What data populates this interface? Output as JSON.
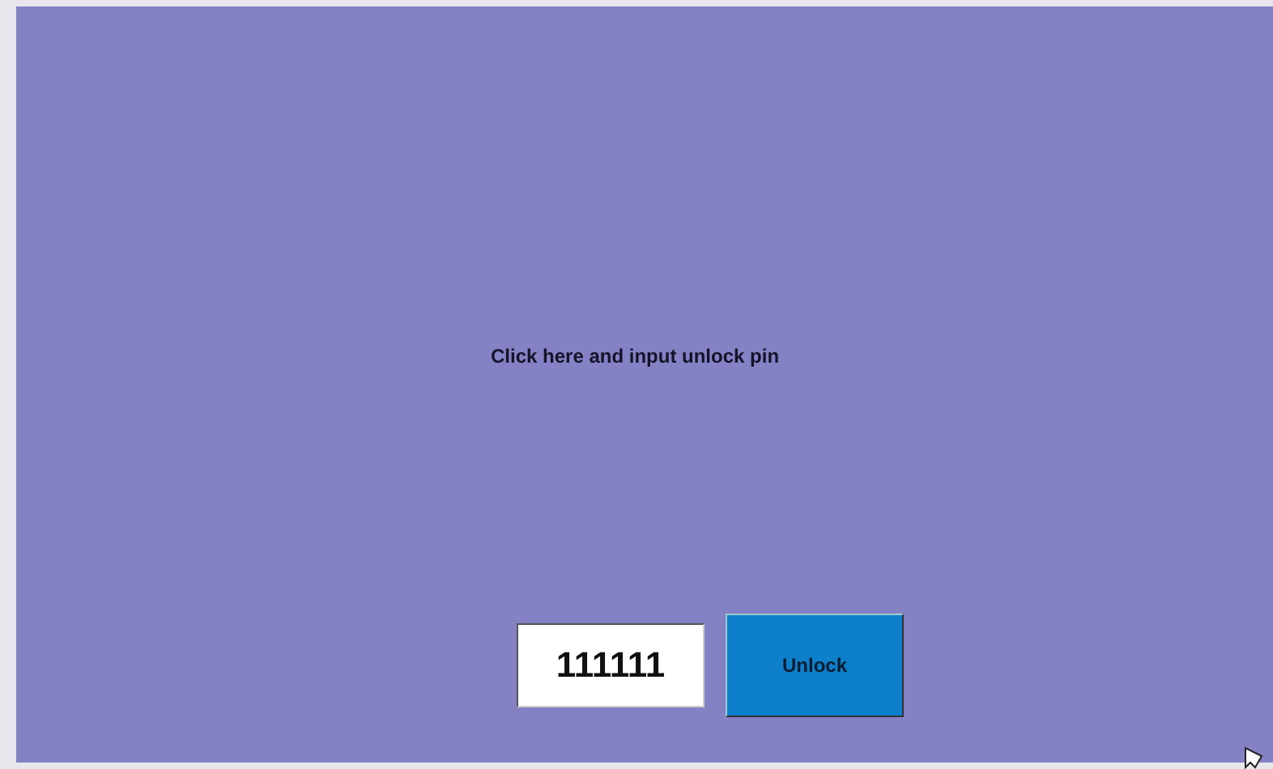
{
  "prompt": "Click here and input unlock pin",
  "pin_field": {
    "value": "111111"
  },
  "unlock_button": {
    "label": "Unlock"
  }
}
